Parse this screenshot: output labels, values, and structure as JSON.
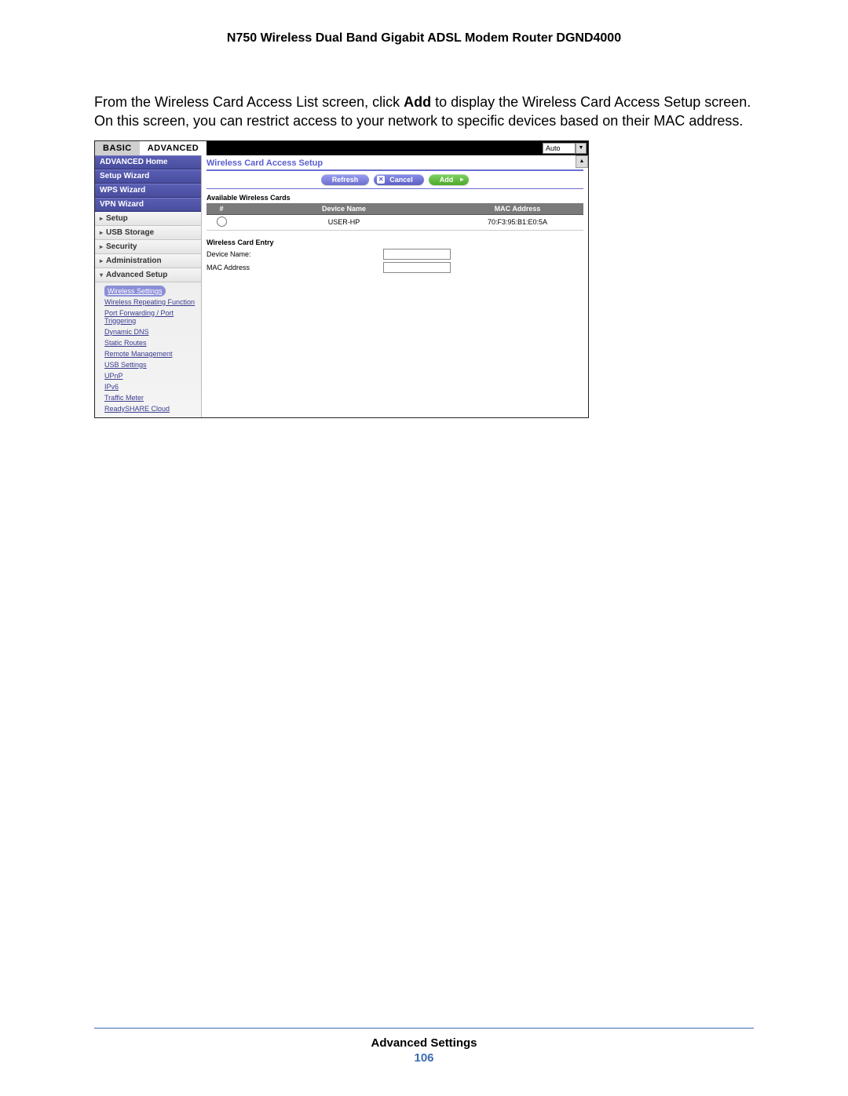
{
  "doc_title": "N750 Wireless Dual Band Gigabit ADSL Modem Router DGND4000",
  "intro_before": "From the Wireless Card Access List screen, click ",
  "intro_bold": "Add",
  "intro_after": " to display the Wireless Card Access Setup screen. On this screen, you can restrict access to your network to specific devices based on their MAC address.",
  "tabs": {
    "basic": "BASIC",
    "advanced": "ADVANCED"
  },
  "auto_label": "Auto",
  "sidebar": {
    "primary": [
      "ADVANCED Home",
      "Setup Wizard",
      "WPS Wizard",
      "VPN Wizard"
    ],
    "subs": [
      "Setup",
      "USB Storage",
      "Security",
      "Administration",
      "Advanced Setup"
    ],
    "submenu": [
      "Wireless Settings",
      "Wireless Repeating Function",
      "Port Forwarding / Port Triggering",
      "Dynamic DNS",
      "Static Routes",
      "Remote Management",
      "USB Settings",
      "UPnP",
      "IPv6",
      "Traffic Meter",
      "ReadySHARE Cloud"
    ]
  },
  "panel": {
    "title": "Wireless Card Access Setup",
    "buttons": {
      "refresh": "Refresh",
      "cancel": "Cancel",
      "add": "Add"
    },
    "available_label": "Available Wireless Cards",
    "headers": {
      "num": "#",
      "device": "Device Name",
      "mac": "MAC Address"
    },
    "row": {
      "device": "USER-HP",
      "mac": "70:F3:95:B1:E0:5A"
    },
    "entry_label": "Wireless Card Entry",
    "device_name_label": "Device Name:",
    "mac_label": "MAC Address"
  },
  "footer": {
    "title": "Advanced Settings",
    "page": "106"
  }
}
